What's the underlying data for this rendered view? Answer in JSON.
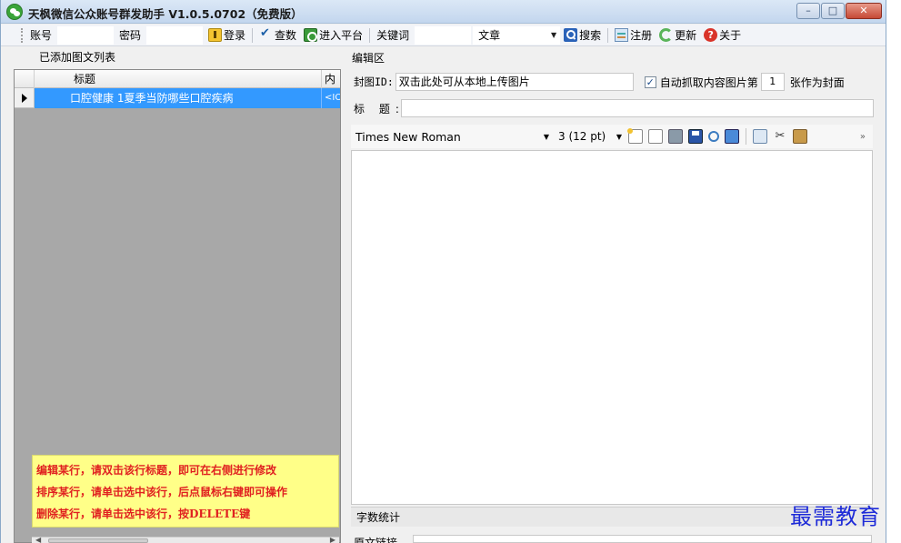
{
  "window": {
    "title": "天枫微信公众账号群发助手 V1.0.5.0702（免费版）"
  },
  "toolbar": {
    "account_label": "账号",
    "password_label": "密码",
    "login_label": "登录",
    "check_label": "查数",
    "enter_platform_label": "进入平台",
    "keyword_label": "关键词",
    "type_select_value": "文章",
    "search_label": "搜索",
    "register_label": "注册",
    "update_label": "更新",
    "about_label": "关于"
  },
  "left_panel": {
    "label": "已添加图文列表",
    "columns": [
      "标题",
      "内"
    ],
    "rows": [
      {
        "title": "口腔健康 1夏季当防哪些口腔疾病",
        "content": "<IO"
      }
    ],
    "hints": [
      "编辑某行，请双击该行标题，即可在右侧进行修改",
      "排序某行，请单击选中该行，后点鼠标右键即可操作",
      "删除某行，请单击选中该行，按DELETE键"
    ]
  },
  "editor": {
    "section_label": "编辑区",
    "cover_label": "封图ID:",
    "cover_value": "双击此处可从本地上传图片",
    "auto_cover_checked": true,
    "auto_cover_text": "自动抓取内容图片第",
    "auto_cover_index": "1",
    "auto_cover_suffix": "张作为封面",
    "title_label": "标 题:",
    "title_value": "",
    "font_name": "Times New Roman",
    "font_size": "3 (12 pt)",
    "word_count_label": "字数统计",
    "original_link_label": "原文链接"
  },
  "watermark": "最需教育",
  "colors": {
    "selection": "#3399ff",
    "hint_bg": "#ffff88",
    "hint_text": "#e02020",
    "watermark": "#1d2ad8"
  }
}
